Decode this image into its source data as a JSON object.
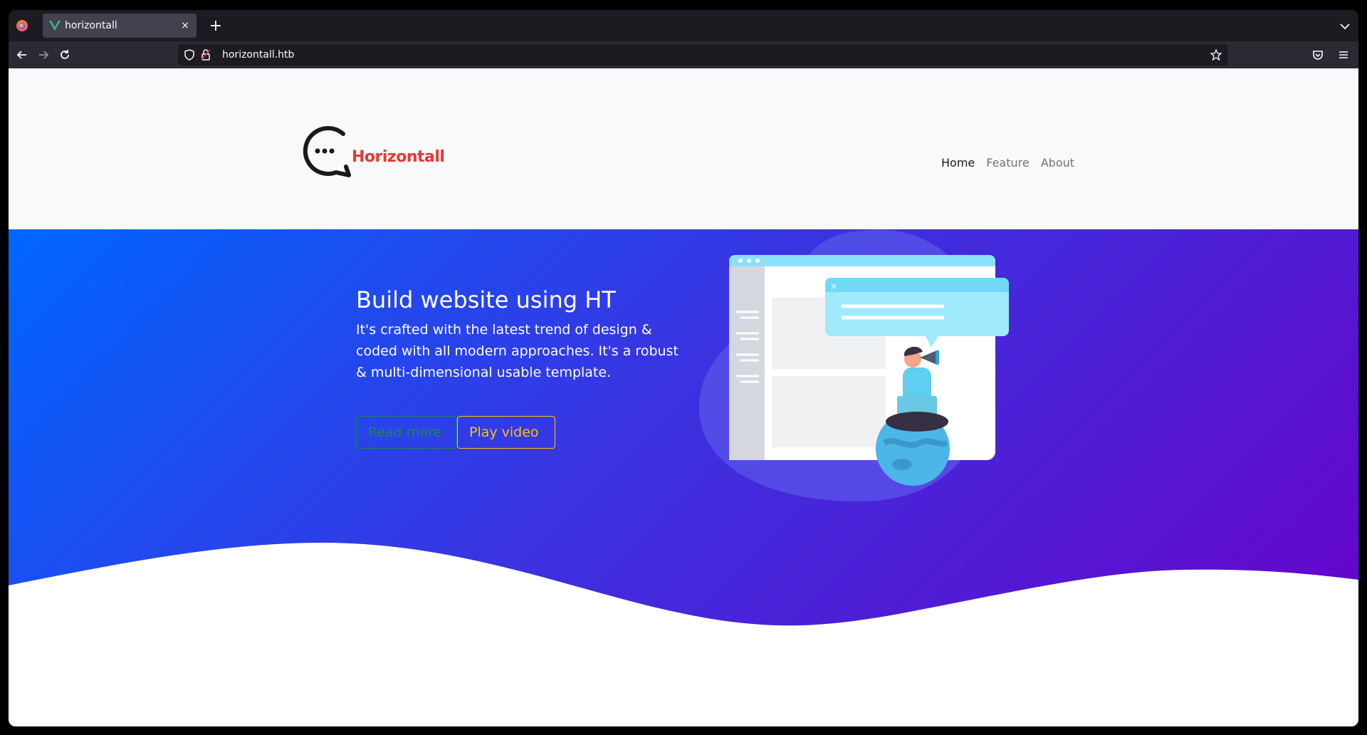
{
  "browser": {
    "tab_title": "horizontall",
    "tab_close": "×",
    "new_tab": "+",
    "url": "horizontall.htb"
  },
  "site": {
    "logo_text": "Horizontall",
    "nav": [
      {
        "label": "Home",
        "active": true
      },
      {
        "label": "Feature",
        "active": false
      },
      {
        "label": "About",
        "active": false
      }
    ]
  },
  "hero": {
    "title": "Build website using HT",
    "text": "It's crafted with the latest trend of design & coded with all modern approaches. It's a robust & multi-dimensional usable template.",
    "read_more": "Read more",
    "play_video": "Play video"
  },
  "colors": {
    "hero_start": "#0066ff",
    "hero_end": "#6a00c8",
    "logo_red": "#e53935",
    "btn_success": "#198754",
    "btn_warning": "#ffc107"
  }
}
